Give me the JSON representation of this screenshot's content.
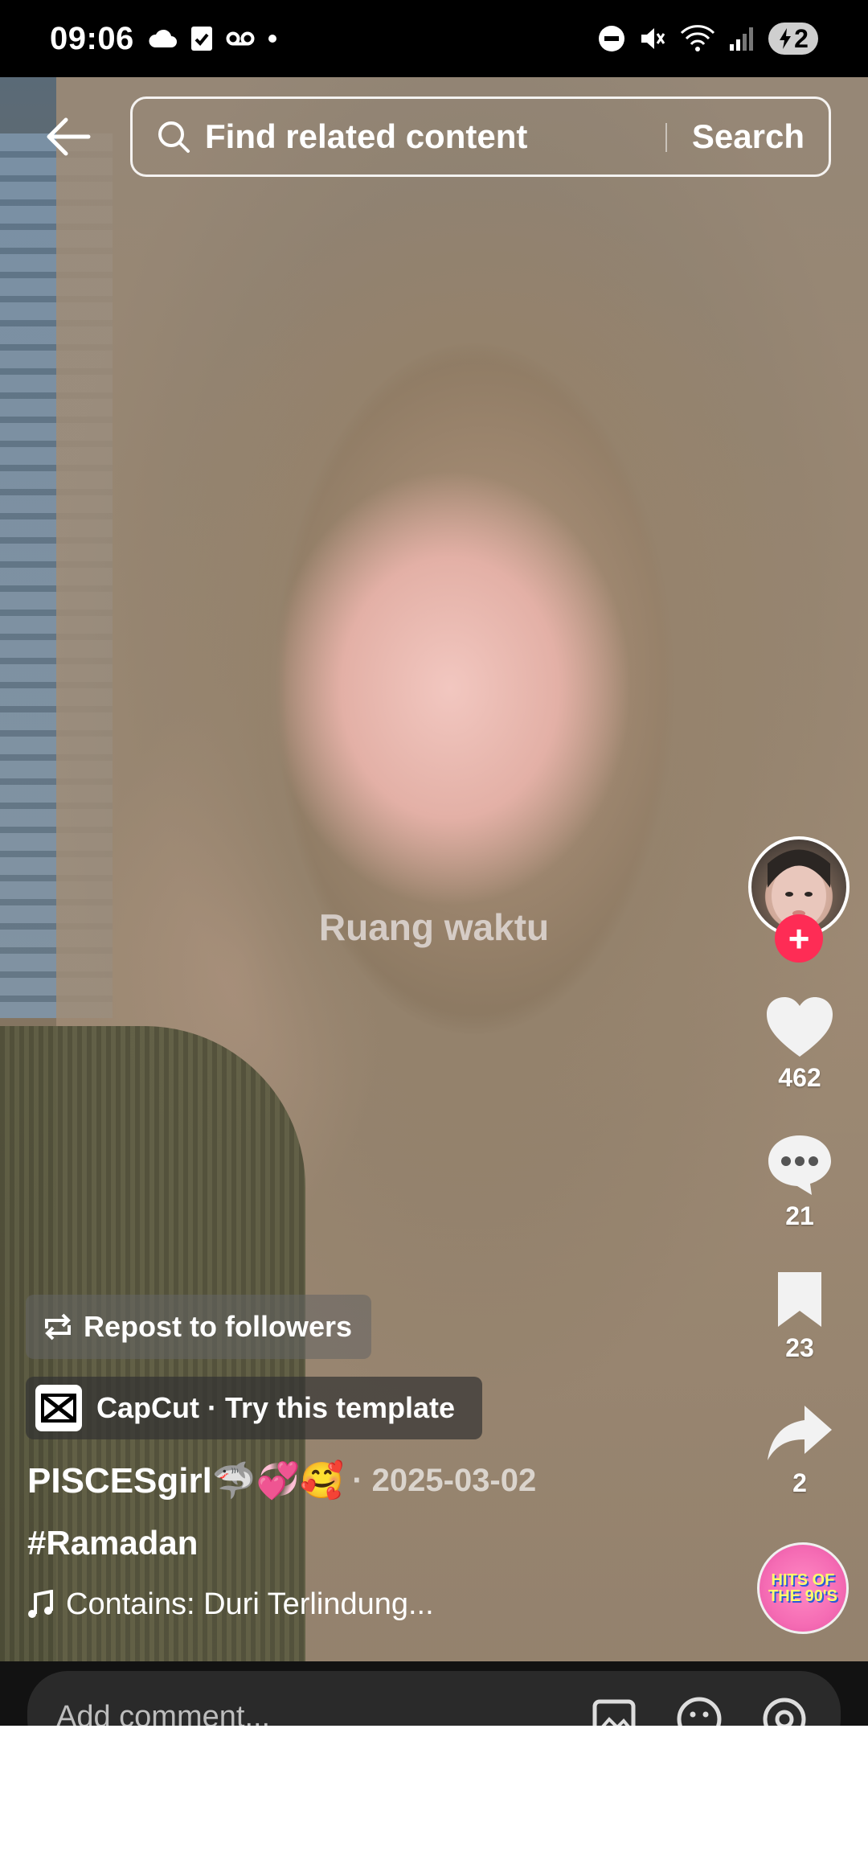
{
  "status_bar": {
    "time": "09:06",
    "left_icons": [
      "cloud-icon",
      "checkbox-icon",
      "voicemail-icon",
      "dot-icon"
    ],
    "right_icons": [
      "dnd-icon",
      "mute-icon",
      "wifi-icon",
      "signal-icon"
    ],
    "battery_level": "2"
  },
  "search": {
    "placeholder": "Find related content",
    "button_label": "Search"
  },
  "video": {
    "watermark_text": "Ruang waktu"
  },
  "actions": {
    "likes": "462",
    "comments": "21",
    "bookmarks": "23",
    "shares": "2"
  },
  "music_disc": {
    "line1": "HITS OF",
    "line2": "THE 90'S"
  },
  "post": {
    "repost_label": "Repost to followers",
    "capcut_label": "CapCut · Try this template",
    "username": "PISCESgirl🦈💞🥰",
    "date": "· 2025-03-02",
    "hashtag": "#Ramadan",
    "sound": "Contains: Duri Terlindung..."
  },
  "comment_bar": {
    "placeholder": "Add comment..."
  },
  "colors": {
    "follow_accent": "#fe2c55",
    "status_bar_bg": "#000000"
  }
}
